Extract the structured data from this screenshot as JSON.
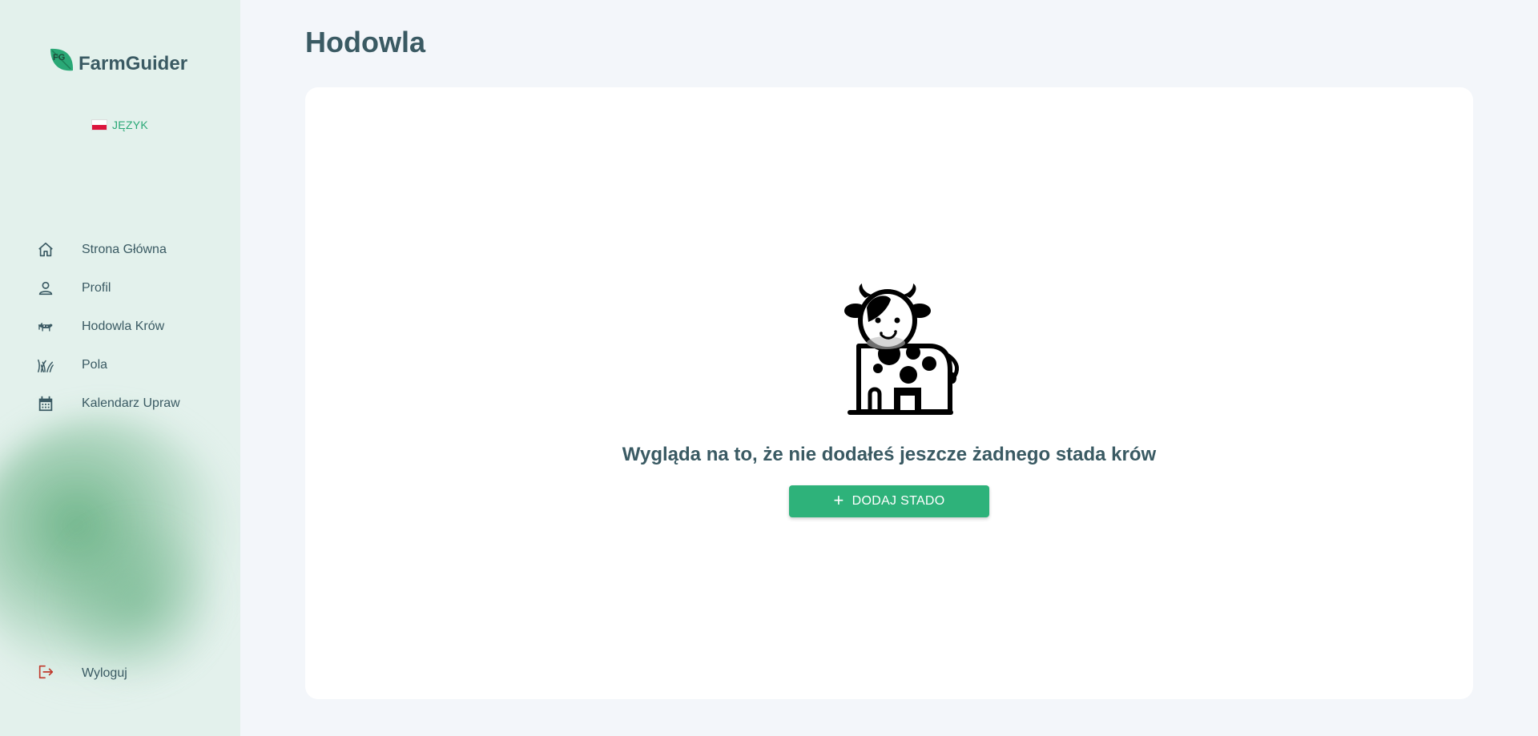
{
  "app": {
    "name": "FarmGuider",
    "logo_icon": "leaf-logo-icon"
  },
  "language": {
    "label": "JĘZYK",
    "flag": "poland-flag-icon"
  },
  "sidebar": {
    "items": [
      {
        "label": "Strona Główna",
        "icon": "home-icon"
      },
      {
        "label": "Profil",
        "icon": "user-icon"
      },
      {
        "label": "Hodowla Krów",
        "icon": "cow-icon"
      },
      {
        "label": "Pola",
        "icon": "grass-icon"
      },
      {
        "label": "Kalendarz Upraw",
        "icon": "calendar-icon"
      }
    ],
    "logout": {
      "label": "Wyloguj",
      "icon": "logout-icon"
    }
  },
  "main": {
    "title": "Hodowla",
    "empty_state": {
      "illustration": "cow-illustration",
      "message": "Wygląda na to, że nie dodałeś jeszcze żadnego stada krów",
      "button_label": "DODAJ STADO",
      "button_icon": "plus-icon"
    }
  },
  "colors": {
    "sidebar_bg": "#e3f1ec",
    "page_bg": "#f3f6fa",
    "text": "#3a5a63",
    "accent": "#2eb27a",
    "logout_icon": "#c0392b"
  }
}
